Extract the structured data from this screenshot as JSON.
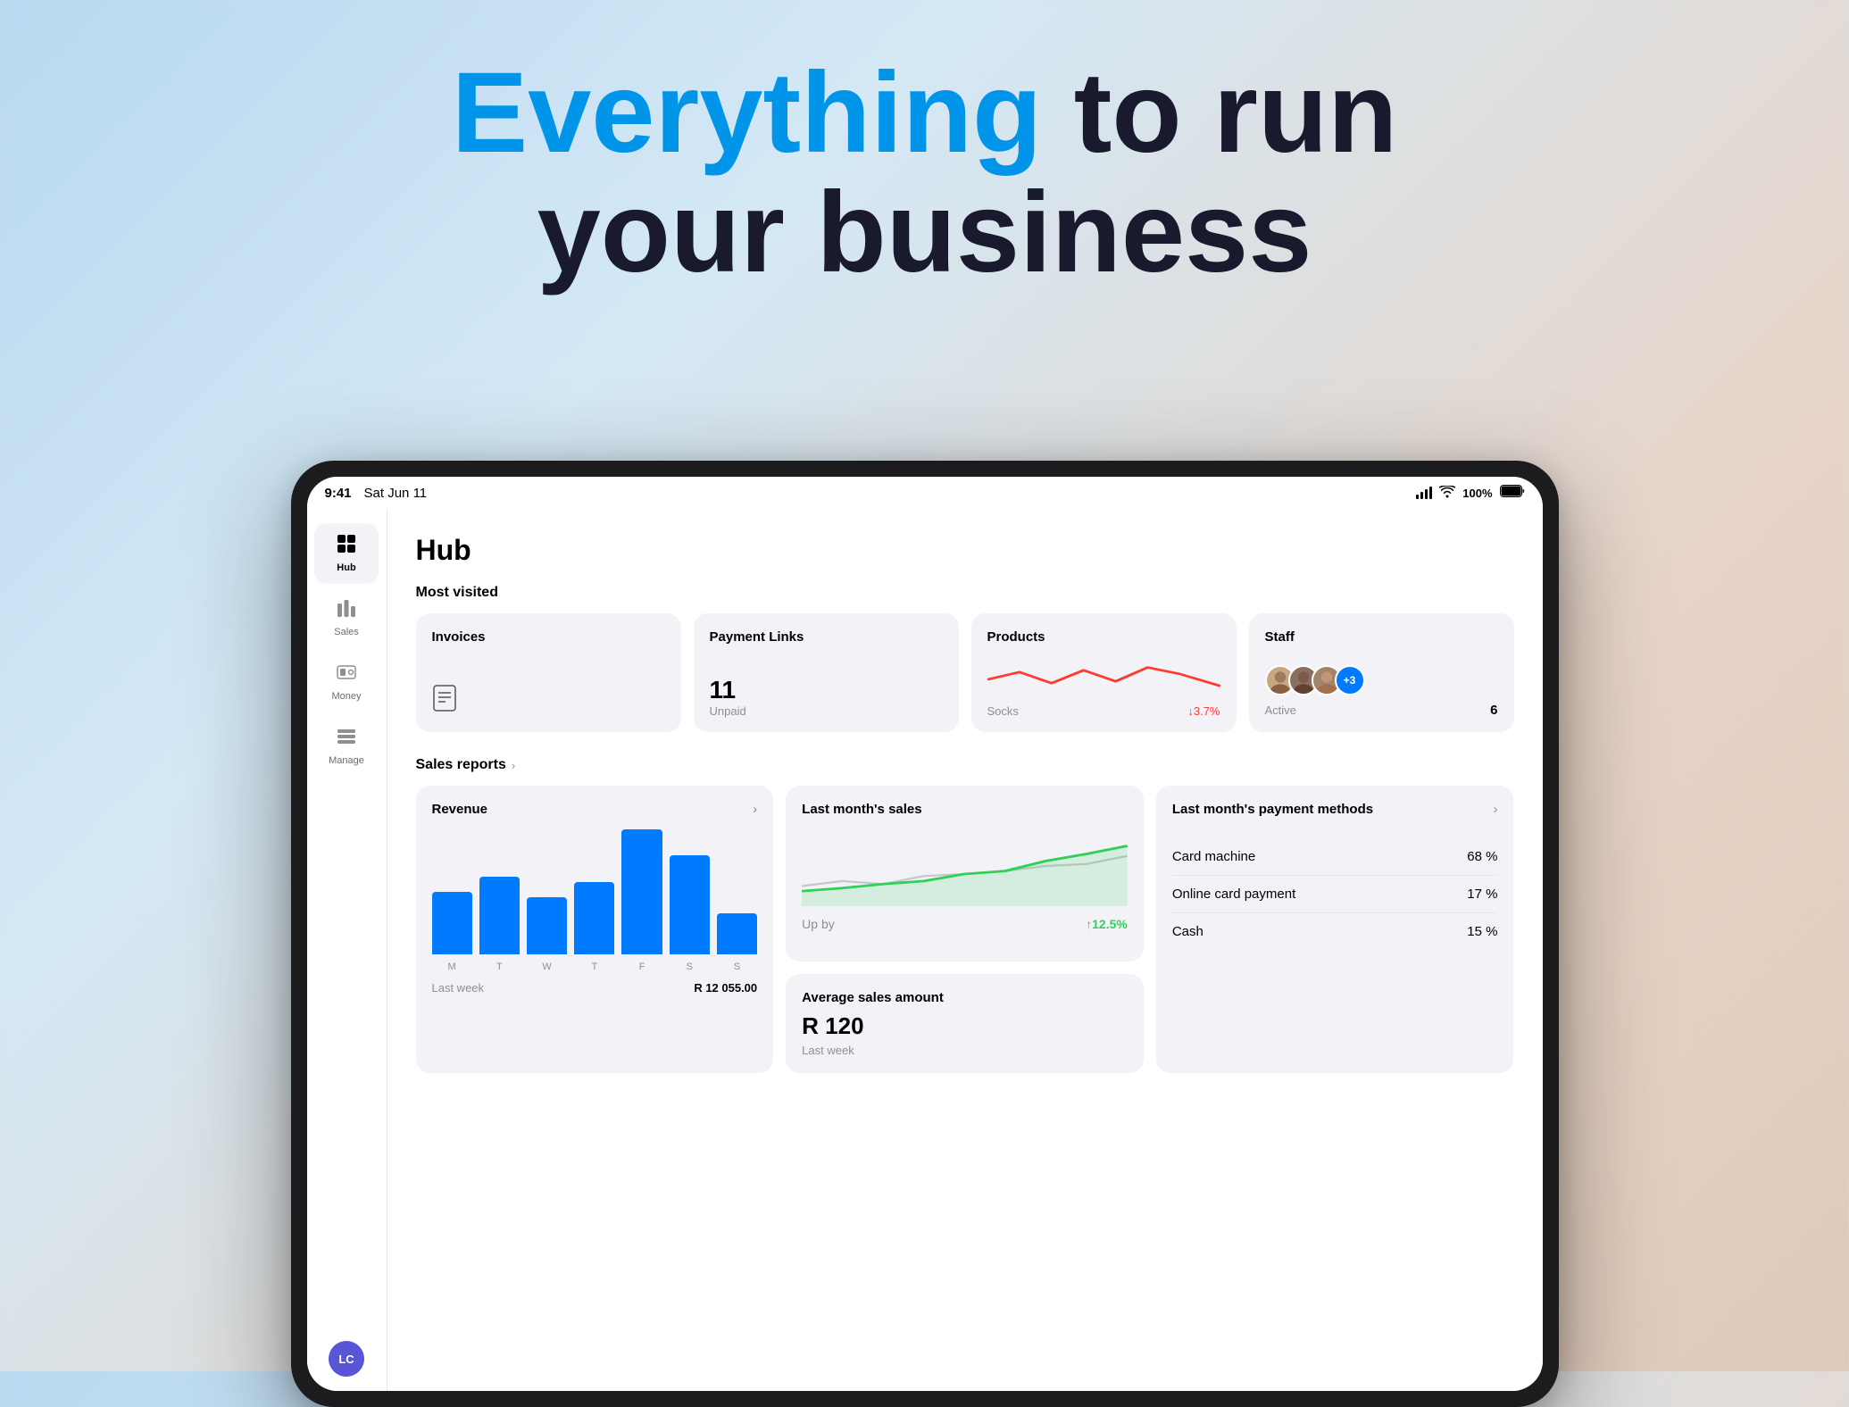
{
  "hero": {
    "line1_blue": "Everything",
    "line1_dark": " to run",
    "line2": "your business"
  },
  "status_bar": {
    "time": "9:41",
    "date": "Sat Jun 11",
    "battery": "100%"
  },
  "sidebar": {
    "items": [
      {
        "label": "Hub",
        "icon": "⊞",
        "active": true
      },
      {
        "label": "Sales",
        "icon": "📈",
        "active": false
      },
      {
        "label": "Money",
        "icon": "🪙",
        "active": false
      },
      {
        "label": "Manage",
        "icon": "🗄️",
        "active": false
      }
    ],
    "avatar_initials": "LC"
  },
  "page_title": "Hub",
  "most_visited": {
    "section_label": "Most visited",
    "cards": [
      {
        "title": "Invoices",
        "type": "icon",
        "bottom_label": ""
      },
      {
        "title": "Payment Links",
        "number": "11",
        "sublabel": "Unpaid"
      },
      {
        "title": "Products",
        "product_name": "Socks",
        "trend": "↓3.7%",
        "trend_type": "down"
      },
      {
        "title": "Staff",
        "active_label": "Active",
        "count": "6"
      }
    ]
  },
  "sales_reports": {
    "title": "Sales reports",
    "revenue_card": {
      "title": "Revenue",
      "bars": [
        60,
        75,
        55,
        70,
        120,
        95,
        40
      ],
      "labels": [
        "M",
        "T",
        "W",
        "T",
        "F",
        "S",
        "S"
      ],
      "period": "Last week",
      "amount": "R 12 055.00"
    },
    "last_month_sales": {
      "title": "Last month's sales",
      "up_label": "Up by",
      "up_value": "↑12.5%"
    },
    "average_sales": {
      "title": "Average sales amount",
      "amount": "R 120",
      "period": "Last week"
    },
    "payment_methods": {
      "title": "Last month's payment methods",
      "methods": [
        {
          "name": "Card machine",
          "pct": "68 %"
        },
        {
          "name": "Online card payment",
          "pct": "17 %"
        },
        {
          "name": "Cash",
          "pct": "15 %"
        }
      ]
    }
  }
}
